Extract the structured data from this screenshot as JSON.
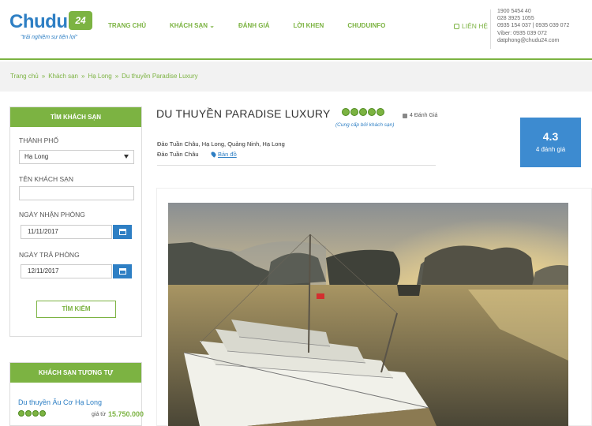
{
  "logo": {
    "word": "Chudu",
    "badge": "24",
    "tagline": "\"trải nghiệm sự tiện lợi\""
  },
  "nav": {
    "items": [
      "TRANG CHỦ",
      "KHÁCH SẠN ⌄",
      "ĐÁNH GIÁ",
      "LỜI KHEN",
      "CHUDUINFO"
    ]
  },
  "contact": {
    "label": "LIÊN HỆ",
    "lines": [
      "1900 5454 40",
      "028 3925 1055",
      "0935 154 037 | 0935 039 072",
      "Viber: 0935 039 072",
      "datphong@chudu24.com"
    ]
  },
  "breadcrumb": {
    "items": [
      "Trang chủ",
      "Khách sạn",
      "Hạ Long",
      "Du thuyền Paradise Luxury"
    ],
    "separator": "»"
  },
  "search": {
    "title": "TÌM KHÁCH SẠN",
    "city_label": "THÀNH PHỐ",
    "city_value": "Hạ Long",
    "hotel_label": "TÊN KHÁCH SẠN",
    "hotel_value": "",
    "checkin_label": "NGÀY NHẬN PHÒNG",
    "checkin_value": "11/11/2017",
    "checkout_label": "NGÀY TRẢ PHÒNG",
    "checkout_value": "12/11/2017",
    "button": "TÌM KIẾM"
  },
  "similar": {
    "title": "KHÁCH SẠN TƯƠNG TỰ",
    "item_name": "Du thuyền Âu Cơ Hạ Long",
    "price_label": "giá từ",
    "price": "15.750.000",
    "rating": 4
  },
  "hotel": {
    "name": "DU THUYỀN PARADISE LUXURY",
    "rating": 5,
    "rating_note": "(Cung cấp bởi khách sạn)",
    "reviews_small": "4 Đánh Giá",
    "address": "Đảo Tuần Châu, Hạ Long, Quảng Ninh, Hạ Long",
    "area": "Đảo Tuần Châu",
    "map_link": "Bản đồ",
    "score": "4.3",
    "score_sub": "4 đánh giá"
  },
  "colors": {
    "brand_green": "#7cb342",
    "brand_blue": "#2e7fc4",
    "score_blue": "#3d8bd0"
  }
}
